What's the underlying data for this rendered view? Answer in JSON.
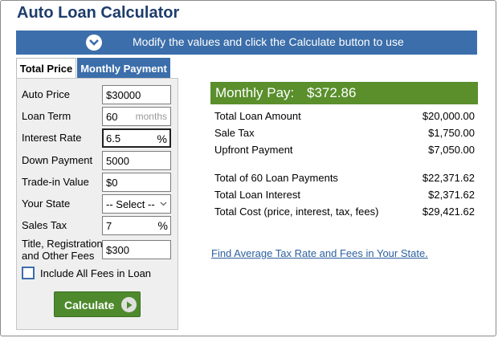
{
  "title": "Auto Loan Calculator",
  "banner": {
    "message": "Modify the values and click the Calculate button to use",
    "icon": "chevron-down-icon"
  },
  "tabs": [
    {
      "label": "Total Price",
      "active": true
    },
    {
      "label": "Monthly Payment",
      "active": false
    }
  ],
  "form": {
    "auto_price": {
      "label": "Auto Price",
      "value": "$30000"
    },
    "loan_term": {
      "label": "Loan Term",
      "value": "60",
      "unit": "months"
    },
    "interest_rate": {
      "label": "Interest Rate",
      "value": "6.5",
      "unit": "%"
    },
    "down_payment": {
      "label": "Down Payment",
      "value": "5000"
    },
    "trade_in": {
      "label": "Trade-in Value",
      "value": "$0"
    },
    "state": {
      "label": "Your State",
      "value": "-- Select --"
    },
    "sales_tax": {
      "label": "Sales Tax",
      "value": "7",
      "unit": "%"
    },
    "fees": {
      "label_line1": "Title, Registration",
      "label_line2": "and Other Fees",
      "value": "$300"
    },
    "include_fees": {
      "label": "Include All Fees in Loan",
      "checked": false
    },
    "calculate_label": "Calculate"
  },
  "results": {
    "monthly_label": "Monthly Pay:",
    "monthly_value": "$372.86",
    "rows": [
      {
        "label": "Total Loan Amount",
        "value": "$20,000.00"
      },
      {
        "label": "Sale Tax",
        "value": "$1,750.00"
      },
      {
        "label": "Upfront Payment",
        "value": "$7,050.00"
      },
      {
        "label": "Total of 60 Loan Payments",
        "value": "$22,371.62"
      },
      {
        "label": "Total Loan Interest",
        "value": "$2,371.62"
      },
      {
        "label": "Total Cost (price, interest, tax, fees)",
        "value": "$29,421.62"
      }
    ],
    "link_text": "Find Average Tax Rate and Fees in Your State."
  },
  "colors": {
    "title": "#1d3d6c",
    "banner": "#3b6eaa",
    "button": "#4e8a2d",
    "result_header": "#5a8f2c",
    "link": "#2c5f9e"
  }
}
